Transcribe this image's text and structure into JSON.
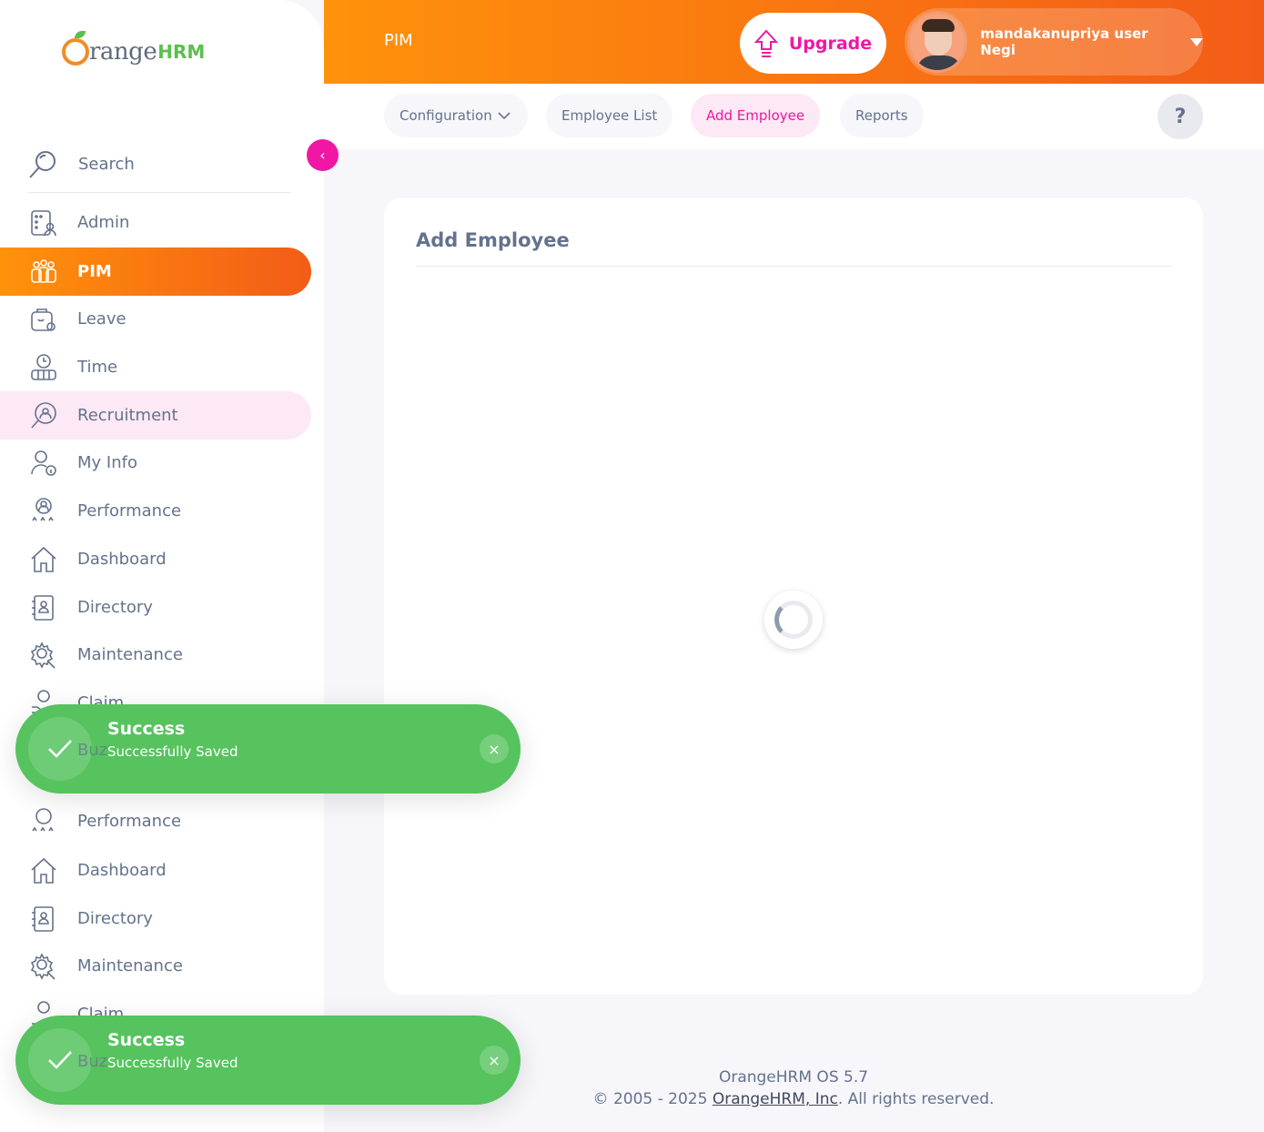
{
  "brand": {
    "logo_main": "range",
    "logo_hrm": "HRM",
    "orange": "#ff920b",
    "pink": "#ef17a3",
    "success": "#56c35e"
  },
  "header": {
    "module": "PIM",
    "upgrade_label": "Upgrade",
    "user_name": "mandakanupriya user Negi"
  },
  "sidebar": {
    "search_label": "Search",
    "items": [
      {
        "label": "Admin",
        "icon": "admin-icon"
      },
      {
        "label": "PIM",
        "icon": "pim-icon"
      },
      {
        "label": "Leave",
        "icon": "leave-icon"
      },
      {
        "label": "Time",
        "icon": "time-icon"
      },
      {
        "label": "Recruitment",
        "icon": "recruitment-icon"
      },
      {
        "label": "My Info",
        "icon": "my-info-icon"
      },
      {
        "label": "Performance",
        "icon": "performance-icon"
      },
      {
        "label": "Dashboard",
        "icon": "dashboard-icon"
      },
      {
        "label": "Directory",
        "icon": "directory-icon"
      },
      {
        "label": "Maintenance",
        "icon": "maintenance-icon"
      },
      {
        "label": "Claim",
        "icon": "claim-icon"
      },
      {
        "label": "Buzz",
        "icon": "buzz-icon"
      }
    ],
    "ghost_items": [
      {
        "label": "Performance"
      },
      {
        "label": "Dashboard"
      },
      {
        "label": "Directory"
      },
      {
        "label": "Maintenance"
      },
      {
        "label": "Claim"
      }
    ]
  },
  "tabs": {
    "configuration": "Configuration",
    "employee_list": "Employee List",
    "add_employee": "Add Employee",
    "reports": "Reports",
    "help": "?"
  },
  "main": {
    "title": "Add Employee"
  },
  "footer": {
    "version": "OrangeHRM OS 5.7",
    "copyright_prefix": "© 2005 - 2025 ",
    "company_link": "OrangeHRM, Inc",
    "copyright_suffix": ". All rights reserved."
  },
  "toasts": [
    {
      "title": "Success",
      "message": "Successfully Saved",
      "close": "×",
      "under_text": "Buz"
    },
    {
      "title": "Success",
      "message": "Successfully Saved",
      "close": "×",
      "under_text": "Buz"
    }
  ]
}
